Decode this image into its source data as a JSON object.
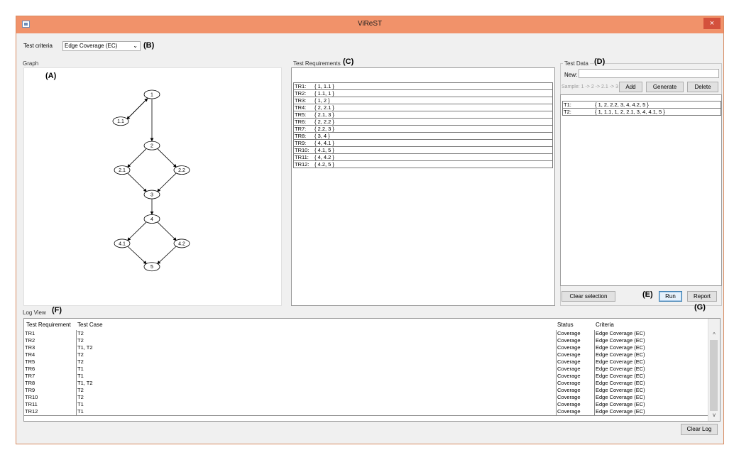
{
  "window": {
    "title": "ViReST",
    "close_glyph": "×"
  },
  "criteria": {
    "label": "Test criteria",
    "value": "Edge Coverage (EC)",
    "arrow": "⌄"
  },
  "callouts": {
    "a": "(A)",
    "b": "(B)",
    "c": "(C)",
    "d": "(D)",
    "e": "(E)",
    "f": "(F)",
    "g": "(G)"
  },
  "graph": {
    "label": "Graph",
    "nodes": [
      "1",
      "1.1",
      "2",
      "2.1",
      "2.2",
      "3",
      "4",
      "4.1",
      "4.2",
      "5"
    ]
  },
  "test_requirements": {
    "label": "Test Requirements",
    "rows": [
      {
        "id": "TR1:",
        "value": "{ 1, 1.1 }"
      },
      {
        "id": "TR2:",
        "value": "{ 1.1, 1 }"
      },
      {
        "id": "TR3:",
        "value": "{ 1, 2 }"
      },
      {
        "id": "TR4:",
        "value": "{ 2, 2.1 }"
      },
      {
        "id": "TR5:",
        "value": "{ 2.1, 3 }"
      },
      {
        "id": "TR6:",
        "value": "{ 2, 2.2 }"
      },
      {
        "id": "TR7:",
        "value": "{ 2.2, 3 }"
      },
      {
        "id": "TR8:",
        "value": "{ 3, 4 }"
      },
      {
        "id": "TR9:",
        "value": "{ 4, 4.1 }"
      },
      {
        "id": "TR10:",
        "value": "{ 4.1, 5 }"
      },
      {
        "id": "TR11:",
        "value": "{ 4, 4.2 }"
      },
      {
        "id": "TR12:",
        "value": "{ 4.2, 5 }"
      }
    ]
  },
  "test_data": {
    "label": "Test Data",
    "new_label": "New:",
    "new_value": "",
    "sample_hint": "Sample: 1 -> 2 -> 2.1 -> 3",
    "add_label": "Add",
    "generate_label": "Generate",
    "delete_label": "Delete",
    "rows": [
      {
        "id": "T1:",
        "value": "{ 1, 2, 2.2, 3, 4, 4.2, 5 }"
      },
      {
        "id": "T2:",
        "value": "{ 1, 1.1, 1, 2, 2.1, 3, 4, 4.1, 5 }"
      }
    ],
    "clear_selection_label": "Clear selection",
    "run_label": "Run",
    "report_label": "Report"
  },
  "log": {
    "label": "Log View",
    "columns": [
      "Test Requirement",
      "Test Case",
      "Status",
      "Criteria"
    ],
    "rows": [
      [
        "TR1",
        "T2",
        "Coverage",
        "Edge Coverage (EC)"
      ],
      [
        "TR2",
        "T2",
        "Coverage",
        "Edge Coverage (EC)"
      ],
      [
        "TR3",
        "T1, T2",
        "Coverage",
        "Edge Coverage (EC)"
      ],
      [
        "TR4",
        "T2",
        "Coverage",
        "Edge Coverage (EC)"
      ],
      [
        "TR5",
        "T2",
        "Coverage",
        "Edge Coverage (EC)"
      ],
      [
        "TR6",
        "T1",
        "Coverage",
        "Edge Coverage (EC)"
      ],
      [
        "TR7",
        "T1",
        "Coverage",
        "Edge Coverage (EC)"
      ],
      [
        "TR8",
        "T1, T2",
        "Coverage",
        "Edge Coverage (EC)"
      ],
      [
        "TR9",
        "T2",
        "Coverage",
        "Edge Coverage (EC)"
      ],
      [
        "TR10",
        "T2",
        "Coverage",
        "Edge Coverage (EC)"
      ],
      [
        "TR11",
        "T1",
        "Coverage",
        "Edge Coverage (EC)"
      ],
      [
        "TR12",
        "T1",
        "Coverage",
        "Edge Coverage (EC)"
      ]
    ],
    "clear_log_label": "Clear Log",
    "scroll_up": "^",
    "scroll_down": "v"
  },
  "colors": {
    "titlebar": "#f1926a",
    "close": "#d4513c",
    "panel_bg": "#f0f0f0"
  }
}
